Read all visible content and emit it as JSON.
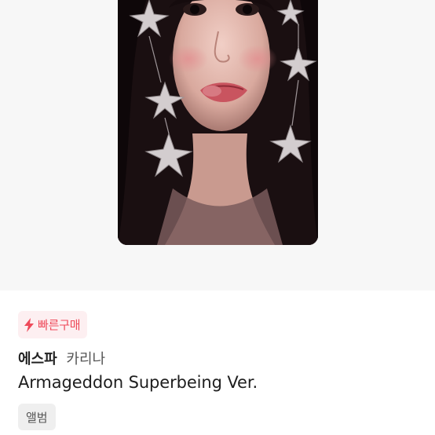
{
  "product": {
    "badge_label": "빠른구매",
    "badge_icon": "lightning-bolt-icon",
    "artist": "에스파",
    "member": "카리나",
    "title": "Armageddon Superbeing Ver.",
    "category": "앨범"
  },
  "colors": {
    "badge_bg": "#fdeff1",
    "badge_accent": "#ee4a5a",
    "tag_bg": "#efefef",
    "image_bg": "#f7f7f7"
  }
}
